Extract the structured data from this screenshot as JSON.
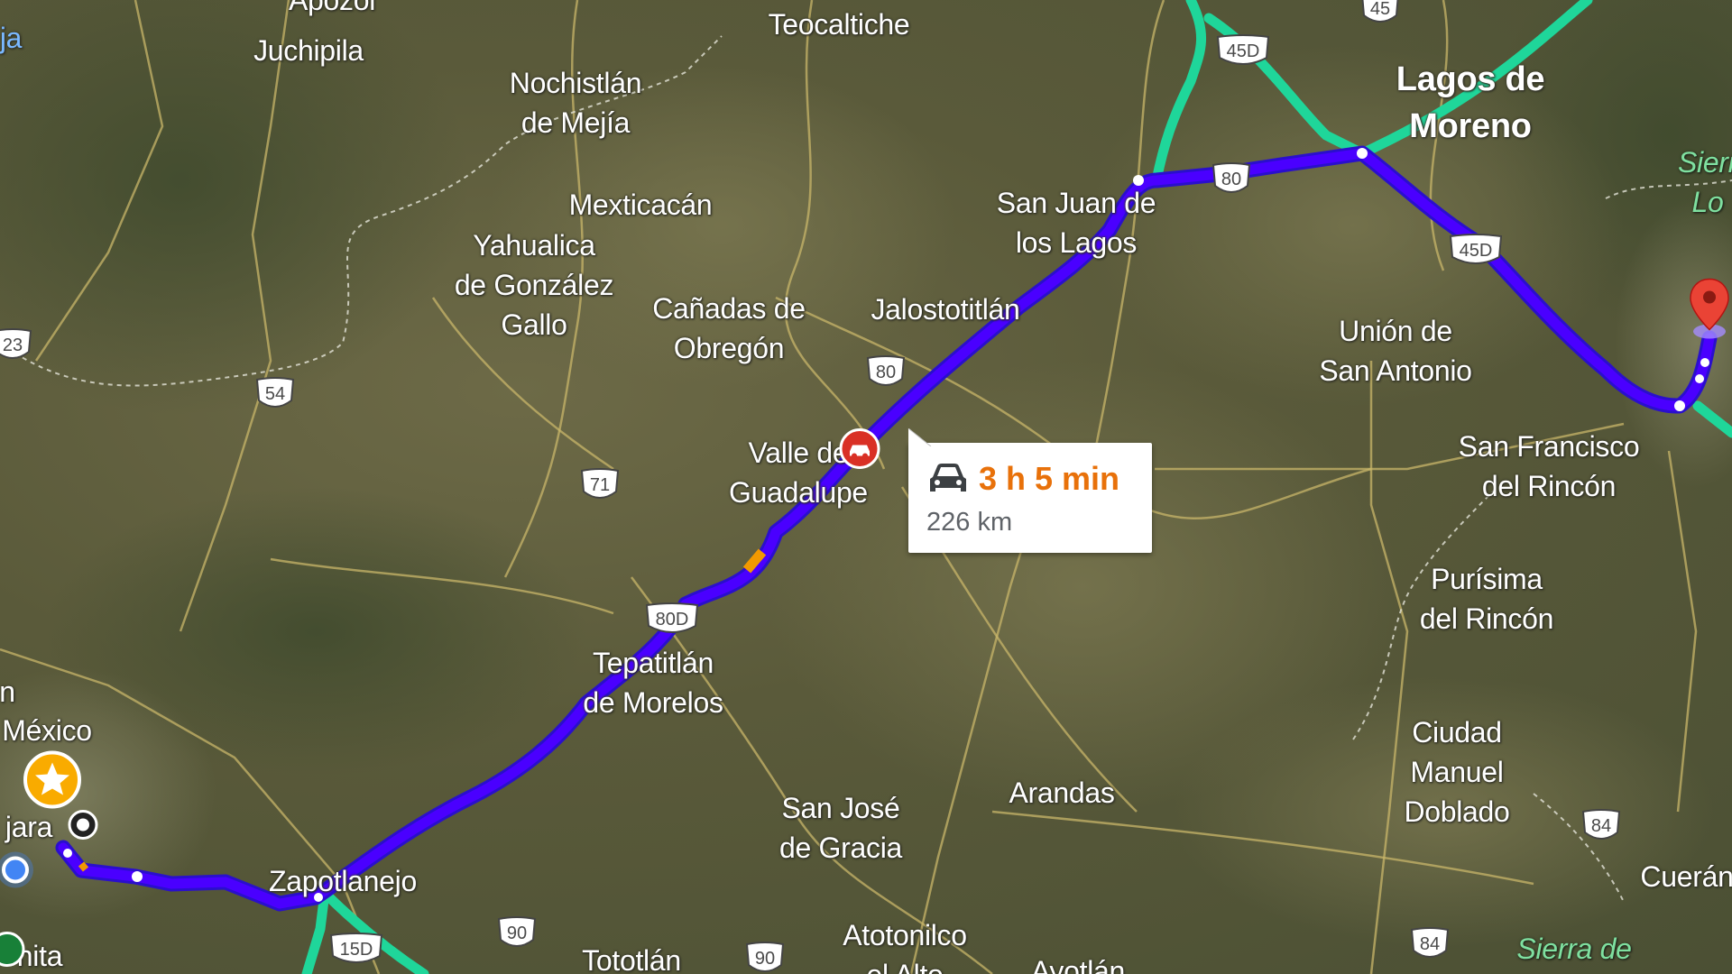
{
  "route_summary": {
    "duration": "3 h 5 min",
    "distance": "226 km",
    "mode": "car-icon",
    "duration_color": "#e8710a"
  },
  "route_color": "#3b00ff",
  "highway_color": "#1fd69a",
  "places": {
    "apozol": "Apozol",
    "teocaltiche": "Teocaltiche",
    "juchipila": "Juchipila",
    "nochistlan": "Nochistlán\nde Mejía",
    "lagos": "Lagos de\nMoreno",
    "mexticacan": "Mexticacán",
    "yahualica": "Yahualica\nde González\nGallo",
    "san_juan": "San Juan de\nlos Lagos",
    "canadas": "Cañadas de\nObregón",
    "jalostotitlan": "Jalostotitlán",
    "union": "Unión de\nSan Antonio",
    "valle": "Valle de\nGuadalupe",
    "san_francisco": "San Francisco\ndel Rincón",
    "purisima": "Purísima\ndel Rincón",
    "tepatitlan": "Tepatitlán\nde Morelos",
    "ciudad_manuel": "Ciudad\nManuel\nDoblado",
    "mexico": "México",
    "arandas": "Arandas",
    "san_jose": "San José\nde Gracia",
    "jara": "jara",
    "zapotlanejo": "Zapotlanejo",
    "atotonilco": "Atotonilco\nel Alto",
    "tototlan": "Tototlán",
    "ayotlan": "Ayotlán",
    "nita": "nita",
    "cueran": "Cuerán",
    "sierra": "Sierra de",
    "sierra_lo": "Sierr\nLo",
    "n_edge": "n",
    "ja_edge": "ja"
  },
  "shields": {
    "s45": "45",
    "s45d_top": "45D",
    "s80_top": "80",
    "s45d_right": "45D",
    "s23": "23",
    "s54": "54",
    "s80_mid": "80",
    "s71": "71",
    "s80d": "80D",
    "s84_right": "84",
    "s90_left": "90",
    "s15d": "15D",
    "s90_bottom": "90",
    "s84_bottom": "84"
  }
}
